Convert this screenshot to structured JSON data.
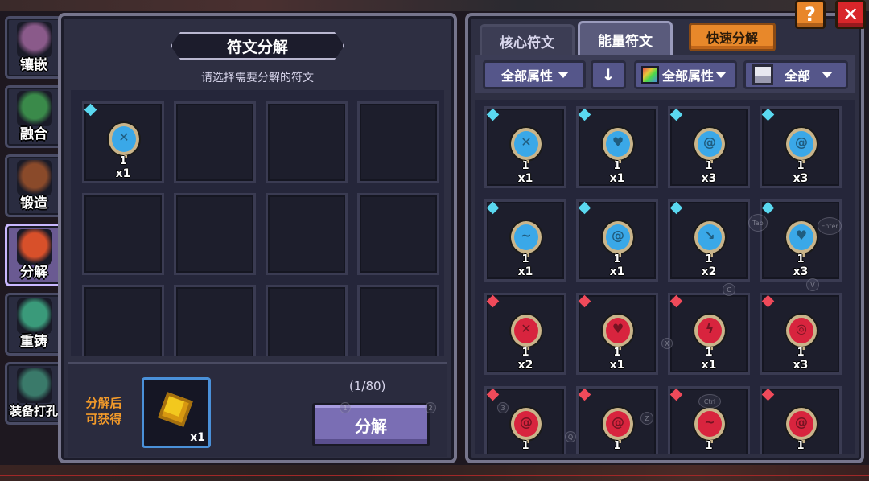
{
  "side_tabs": [
    {
      "label": "镶嵌",
      "active": false,
      "art": "#8a5a8a"
    },
    {
      "label": "融合",
      "active": false,
      "art": "#3a8a4a"
    },
    {
      "label": "锻造",
      "active": false,
      "art": "#8a4a2a"
    },
    {
      "label": "分解",
      "active": true,
      "art": "#d8502a"
    },
    {
      "label": "重铸",
      "active": false,
      "art": "#3a9a7a"
    },
    {
      "label": "装备打孔",
      "active": false,
      "art": "#3a7a6a"
    }
  ],
  "decompose_panel": {
    "title": "符文分解",
    "subtitle": "请选择需要分解的符文",
    "selected": {
      "level": "1",
      "qty": "x1",
      "color": "#3aa8e8",
      "glyph": "✕"
    },
    "obtain_label_1": "分解后",
    "obtain_label_2": "可获得",
    "reward_qty": "x1",
    "count": "(1/80)",
    "decompose_button": "分解"
  },
  "rune_panel": {
    "tabs": [
      {
        "label": "核心符文",
        "active": false
      },
      {
        "label": "能量符文",
        "active": true
      }
    ],
    "quick_decompose": "快速分解",
    "filters": {
      "attr1": "全部属性",
      "sort_icon": "↓",
      "attr2": "全部属性",
      "rarity": "全部"
    },
    "runes": [
      {
        "gem": "#5ad8f0",
        "color": "#3aa8e8",
        "glyph": "✕",
        "level": "1",
        "qty": "x1"
      },
      {
        "gem": "#5ad8f0",
        "color": "#3aa8e8",
        "glyph": "♥",
        "level": "1",
        "qty": "x1"
      },
      {
        "gem": "#5ad8f0",
        "color": "#3aa8e8",
        "glyph": "@",
        "level": "1",
        "qty": "x3"
      },
      {
        "gem": "#5ad8f0",
        "color": "#3aa8e8",
        "glyph": "@",
        "level": "1",
        "qty": "x3"
      },
      {
        "gem": "#5ad8f0",
        "color": "#3aa8e8",
        "glyph": "~",
        "level": "1",
        "qty": "x1"
      },
      {
        "gem": "#5ad8f0",
        "color": "#3aa8e8",
        "glyph": "@",
        "level": "1",
        "qty": "x1"
      },
      {
        "gem": "#5ad8f0",
        "color": "#3aa8e8",
        "glyph": "↘",
        "level": "1",
        "qty": "x2"
      },
      {
        "gem": "#5ad8f0",
        "color": "#3aa8e8",
        "glyph": "♥",
        "level": "1",
        "qty": "x3"
      },
      {
        "gem": "#f04a5a",
        "color": "#d8243e",
        "glyph": "✕",
        "level": "1",
        "qty": "x2"
      },
      {
        "gem": "#f04a5a",
        "color": "#d8243e",
        "glyph": "♥",
        "level": "1",
        "qty": "x1"
      },
      {
        "gem": "#f04a5a",
        "color": "#d8243e",
        "glyph": "ϟ",
        "level": "1",
        "qty": "x1"
      },
      {
        "gem": "#f04a5a",
        "color": "#d8243e",
        "glyph": "◎",
        "level": "1",
        "qty": "x3"
      },
      {
        "gem": "#f04a5a",
        "color": "#d8243e",
        "glyph": "@",
        "level": "1",
        "qty": ""
      },
      {
        "gem": "#f04a5a",
        "color": "#d8243e",
        "glyph": "@",
        "level": "1",
        "qty": ""
      },
      {
        "gem": "#f04a5a",
        "color": "#d8243e",
        "glyph": "~",
        "level": "1",
        "qty": ""
      },
      {
        "gem": "#f04a5a",
        "color": "#d8243e",
        "glyph": "@",
        "level": "1",
        "qty": ""
      }
    ]
  },
  "corner_buttons": {
    "help": "?",
    "close": "✕"
  },
  "key_hints": [
    "Tab",
    "Enter",
    "C",
    "V",
    "X",
    "Ctrl",
    "Z",
    "Q",
    "3",
    "2",
    "1"
  ]
}
